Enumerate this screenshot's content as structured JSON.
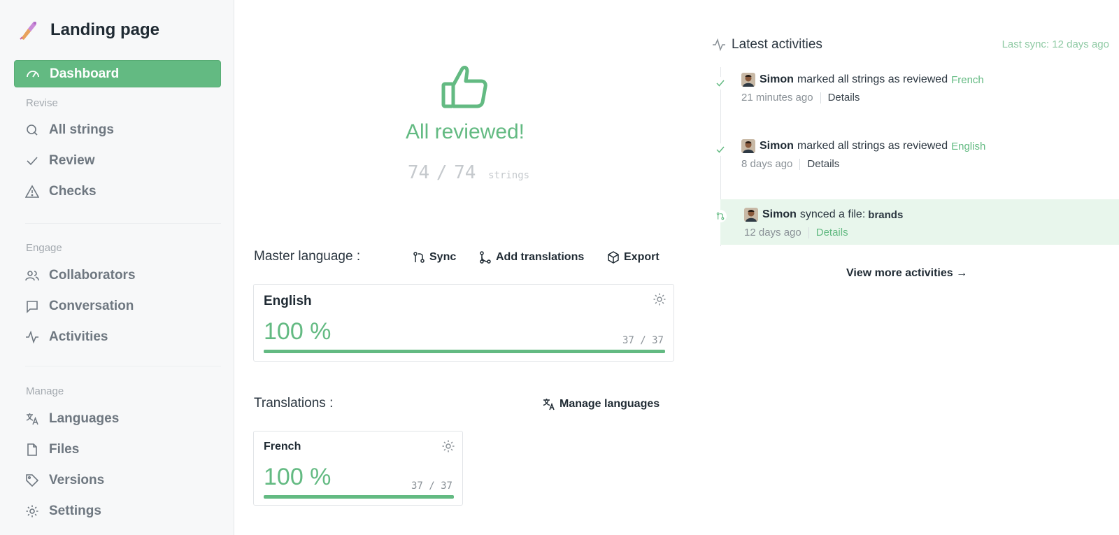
{
  "sidebar": {
    "title": "Landing page",
    "active_item": {
      "label": "Dashboard",
      "icon": "gauge-icon"
    },
    "sections": {
      "revise": "Revise",
      "engage": "Engage",
      "manage": "Manage"
    },
    "items": {
      "all_strings": "All strings",
      "review": "Review",
      "checks": "Checks",
      "collaborators": "Collaborators",
      "conversation": "Conversation",
      "activities": "Activities",
      "languages": "Languages",
      "files": "Files",
      "versions": "Versions",
      "settings": "Settings"
    }
  },
  "hero": {
    "title": "All reviewed!",
    "reviewed": "74",
    "separator": "/",
    "total": "74",
    "unit": "strings"
  },
  "master": {
    "label": "Master language :",
    "actions": {
      "sync": "Sync",
      "add_translations": "Add translations",
      "export": "Export"
    },
    "language": {
      "name": "English",
      "percent": "100 %",
      "count": "37 / 37",
      "progress": 1.0
    }
  },
  "translations": {
    "label": "Translations :",
    "manage_label": "Manage languages",
    "items": [
      {
        "name": "French",
        "percent": "100 %",
        "count": "37 / 37",
        "progress": 1.0
      }
    ]
  },
  "activities": {
    "title": "Latest activities",
    "last_sync": "Last sync: 12 days ago",
    "items": [
      {
        "user": "Simon",
        "action": "marked all strings as reviewed",
        "target": "French",
        "time": "21 minutes ago",
        "details": "Details"
      },
      {
        "user": "Simon",
        "action": "marked all strings as reviewed",
        "target": "English",
        "time": "8 days ago",
        "details": "Details"
      },
      {
        "user": "Simon",
        "action": "synced a file:",
        "target": "brands",
        "time": "12 days ago",
        "details": "Details"
      }
    ],
    "view_more": "View more activities →"
  },
  "colors": {
    "accent": "#63ba82",
    "accent_light": "#e8f6ec",
    "sidebar_bg": "#f7f8f9"
  }
}
